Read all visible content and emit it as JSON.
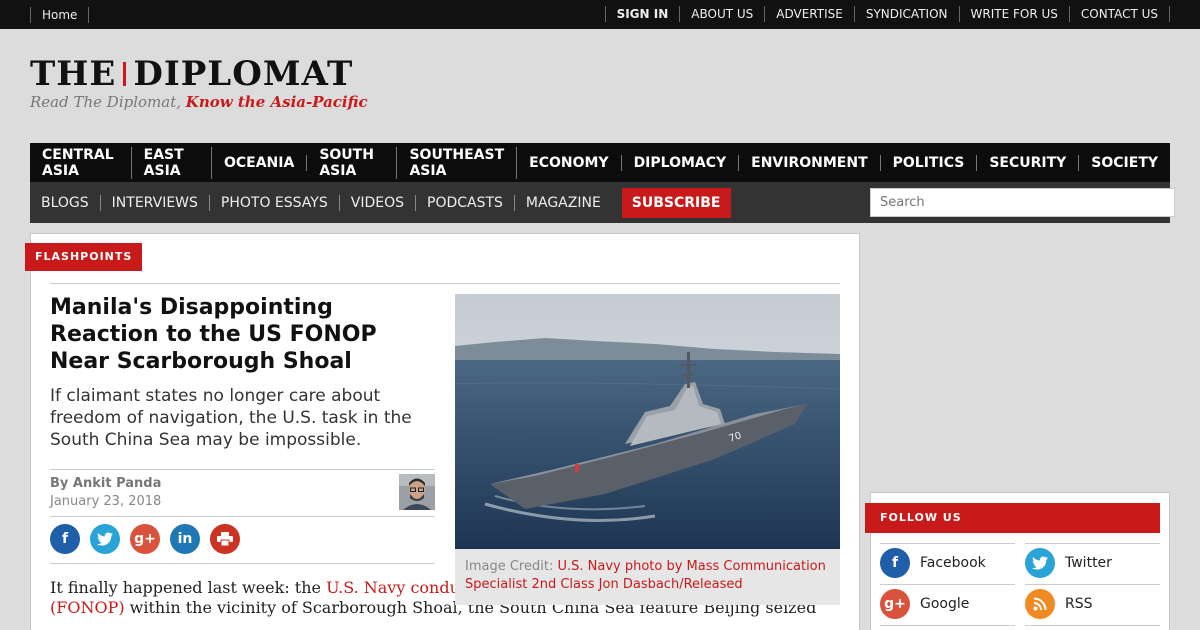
{
  "topbar": {
    "home": "Home",
    "links": [
      "SIGN IN",
      "ABOUT US",
      "ADVERTISE",
      "SYNDICATION",
      "WRITE FOR US",
      "CONTACT US"
    ]
  },
  "logo": {
    "brand_left": "THE",
    "brand_right": "DIPLOMAT",
    "tagline_plain": "Read The Diplomat,",
    "tagline_bold": "Know the Asia-Pacific"
  },
  "nav_primary": [
    "CENTRAL ASIA",
    "EAST ASIA",
    "OCEANIA",
    "SOUTH ASIA",
    "SOUTHEAST ASIA",
    "ECONOMY",
    "DIPLOMACY",
    "ENVIRONMENT",
    "POLITICS",
    "SECURITY",
    "SOCIETY"
  ],
  "nav_secondary": [
    "BLOGS",
    "INTERVIEWS",
    "PHOTO ESSAYS",
    "VIDEOS",
    "PODCASTS",
    "MAGAZINE"
  ],
  "subscribe_label": "SUBSCRIBE",
  "search": {
    "placeholder": "Search"
  },
  "article": {
    "section": "FLASHPOINTS",
    "title": "Manila's Disappointing Reaction to the US FONOP Near Scarborough Shoal",
    "dek": "If claimant states no longer care about freedom of navigation, the U.S. task in the South China Sea may be impossible.",
    "author": "By Ankit Panda",
    "date": "January 23, 2018",
    "caption_prefix": "Image Credit:",
    "caption_link": "U.S. Navy photo by Mass Communication Specialist 2nd Class Jon Dasbach/Released",
    "body_start": "It finally happened last week: the ",
    "body_link": "U.S. Navy conducted a freedom of navigation operation (FONOP)",
    "body_rest": " within the vicinity of Scarborough Shoal, the South China Sea feature Beijing seized",
    "hull_number": "70"
  },
  "follow": {
    "heading": "FOLLOW US",
    "items": [
      "Facebook",
      "Twitter",
      "Google",
      "RSS"
    ]
  },
  "colors": {
    "accent": "#c81a1a",
    "facebook": "#1f5ea8",
    "twitter": "#2aa3d6",
    "google": "#d9533c",
    "linkedin": "#1f78b4",
    "print": "#cc3322",
    "rss": "#f08a24"
  }
}
